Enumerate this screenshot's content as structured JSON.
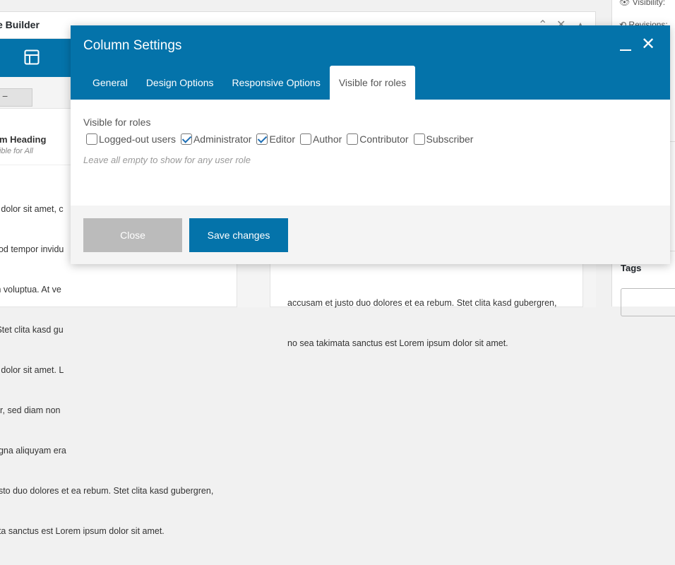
{
  "background": {
    "title": "e Builder",
    "tab_mini": "−",
    "left_column": {
      "title": "om Heading",
      "subtitle": "isible for All",
      "text_lines": [
        "n dolor sit amet, c",
        "nod tempor invidu",
        "m voluptua. At ve",
        " Stet clita kasd gu",
        "n dolor sit amet. L",
        "litr, sed diam non",
        "agna aliquyam era",
        "usto duo dolores et ea rebum. Stet clita kasd gubergren,",
        "ata sanctus est Lorem ipsum dolor sit amet."
      ]
    },
    "right_column": {
      "text_lines": [
        "accusam et justo duo dolores et ea rebum. Stet clita kasd gubergren,",
        "no sea takimata sanctus est Lorem ipsum dolor sit amet."
      ]
    },
    "sidebar": {
      "visibility": "Visibility:",
      "revisions": "Revisions:",
      "tags": "Tags"
    }
  },
  "modal": {
    "title": "Column Settings",
    "tabs": [
      {
        "label": "General"
      },
      {
        "label": "Design Options"
      },
      {
        "label": "Responsive Options"
      },
      {
        "label": "Visible for roles"
      }
    ],
    "field_label": "Visible for roles",
    "roles": [
      {
        "label": "Logged-out users",
        "checked": false
      },
      {
        "label": "Administrator",
        "checked": true
      },
      {
        "label": "Editor",
        "checked": true
      },
      {
        "label": "Author",
        "checked": false
      },
      {
        "label": "Contributor",
        "checked": false
      },
      {
        "label": "Subscriber",
        "checked": false
      }
    ],
    "hint": "Leave all empty to show for any user role",
    "close_label": "Close",
    "save_label": "Save changes"
  },
  "colors": {
    "accent": "#0473aa",
    "close_button": "#bbbbbb"
  }
}
